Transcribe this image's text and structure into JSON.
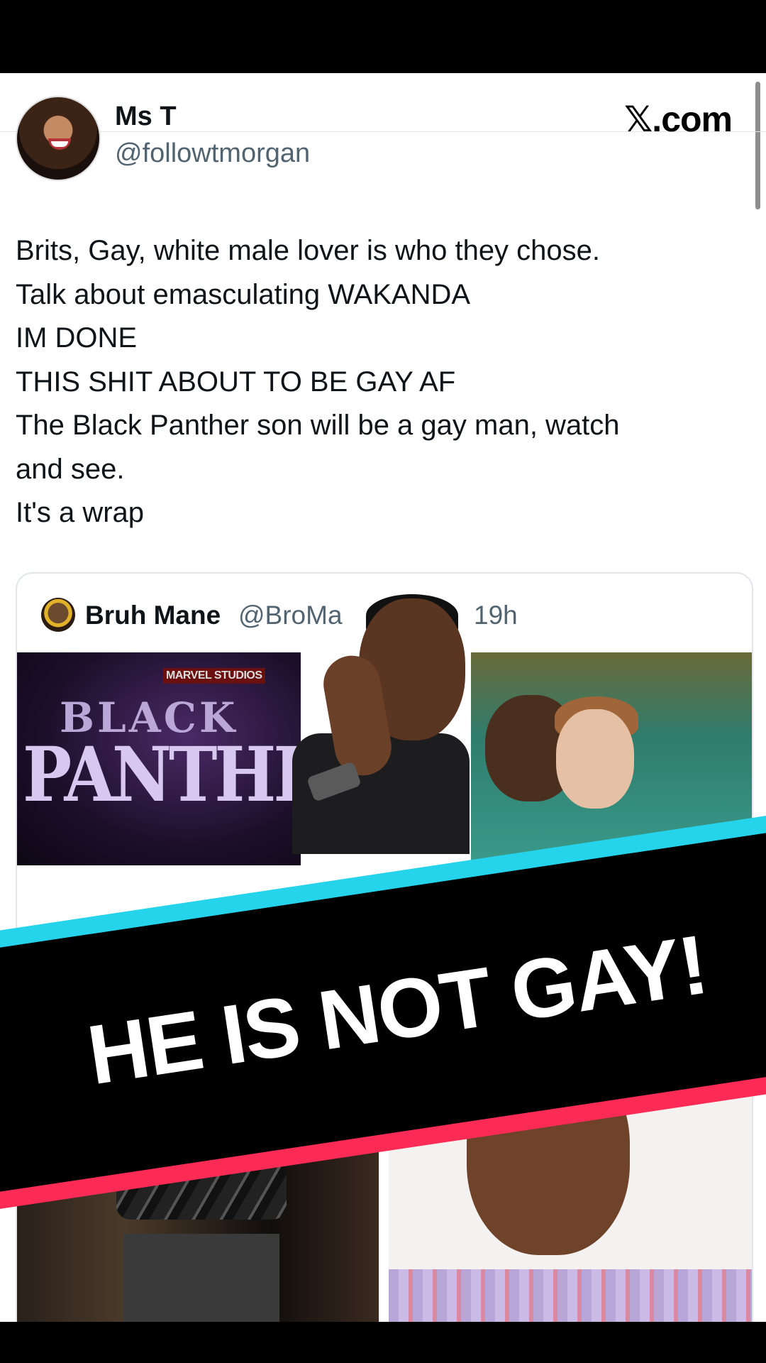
{
  "post": {
    "author_name": "Ms T",
    "author_handle": "@followtmorgan",
    "site": ".com",
    "text_lines": [
      "Brits, Gay, white male lover is who they chose.",
      "Talk about emasculating WAKANDA",
      "IM DONE",
      "THIS SHIT ABOUT TO BE GAY AF",
      "The Black Panther son will be a gay man, watch",
      "and see.",
      "It's a wrap"
    ]
  },
  "quoted_post": {
    "author_name": "Bruh Mane",
    "author_handle": "@BroMa",
    "time": "19h",
    "image_marvel": "MARVEL STUDIOS",
    "image_title_line1": "BLACK",
    "image_title_line2": "PANTHER"
  },
  "overlay": {
    "banner_text": "HE IS NOT GAY!"
  },
  "colors": {
    "banner_cyan": "#25d3ea",
    "banner_pink": "#fb2b55",
    "banner_black": "#000000"
  }
}
